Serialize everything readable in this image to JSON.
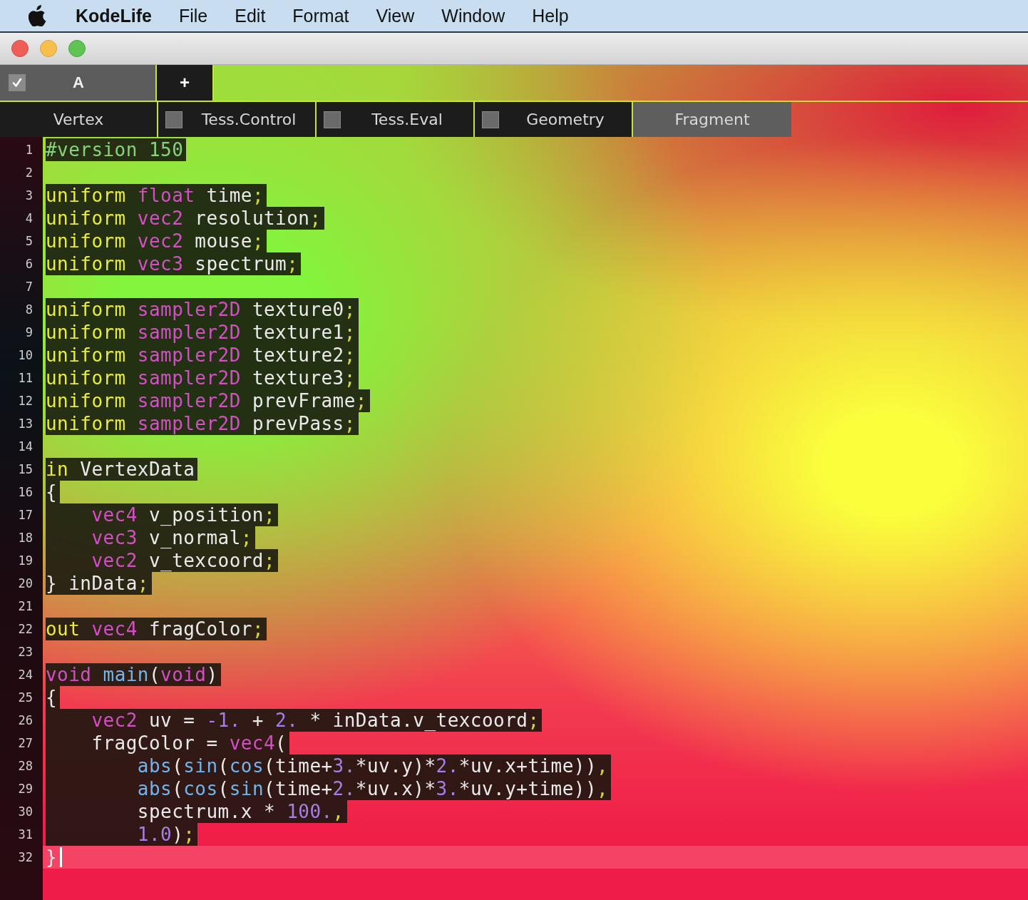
{
  "menu_bar": {
    "app": "KodeLife",
    "items": [
      "File",
      "Edit",
      "Format",
      "View",
      "Window",
      "Help"
    ]
  },
  "project_tabs": [
    {
      "kind": "project",
      "label": "A",
      "checked": true,
      "selected": true
    },
    {
      "kind": "add",
      "label": "+",
      "selected": false
    }
  ],
  "shader_tabs": [
    {
      "kind": "plain",
      "label": "Vertex",
      "selected": false
    },
    {
      "kind": "checkbox",
      "label": "Tess.Control",
      "checked": false,
      "selected": false
    },
    {
      "kind": "checkbox",
      "label": "Tess.Eval",
      "checked": false,
      "selected": false
    },
    {
      "kind": "checkbox",
      "label": "Geometry",
      "checked": false,
      "selected": false
    },
    {
      "kind": "plain",
      "label": "Fragment",
      "selected": true
    }
  ],
  "editor": {
    "lines": [
      {
        "number": "1",
        "tokens": [
          {
            "kind": "pre",
            "text": "#version 150"
          }
        ]
      },
      {
        "number": "2"
      },
      {
        "number": "3",
        "tokens": [
          {
            "kind": "kw",
            "text": "uniform"
          },
          {
            "kind": "type",
            "text": " float"
          },
          {
            "kind": "id",
            "text": " time"
          },
          {
            "kind": "punct",
            "text": ";"
          }
        ]
      },
      {
        "number": "4",
        "tokens": [
          {
            "kind": "kw",
            "text": "uniform"
          },
          {
            "kind": "type",
            "text": " vec2"
          },
          {
            "kind": "id",
            "text": " resolution"
          },
          {
            "kind": "punct",
            "text": ";"
          }
        ]
      },
      {
        "number": "5",
        "tokens": [
          {
            "kind": "kw",
            "text": "uniform"
          },
          {
            "kind": "type",
            "text": " vec2"
          },
          {
            "kind": "id",
            "text": " mouse"
          },
          {
            "kind": "punct",
            "text": ";"
          }
        ]
      },
      {
        "number": "6",
        "tokens": [
          {
            "kind": "kw",
            "text": "uniform"
          },
          {
            "kind": "type",
            "text": " vec3"
          },
          {
            "kind": "id",
            "text": " spectrum"
          },
          {
            "kind": "punct",
            "text": ";"
          }
        ]
      },
      {
        "number": "7"
      },
      {
        "number": "8",
        "tokens": [
          {
            "kind": "kw",
            "text": "uniform"
          },
          {
            "kind": "type",
            "text": " sampler2D"
          },
          {
            "kind": "id",
            "text": " texture0"
          },
          {
            "kind": "punct",
            "text": ";"
          }
        ]
      },
      {
        "number": "9",
        "tokens": [
          {
            "kind": "kw",
            "text": "uniform"
          },
          {
            "kind": "type",
            "text": " sampler2D"
          },
          {
            "kind": "id",
            "text": " texture1"
          },
          {
            "kind": "punct",
            "text": ";"
          }
        ]
      },
      {
        "number": "10",
        "tokens": [
          {
            "kind": "kw",
            "text": "uniform"
          },
          {
            "kind": "type",
            "text": " sampler2D"
          },
          {
            "kind": "id",
            "text": " texture2"
          },
          {
            "kind": "punct",
            "text": ";"
          }
        ]
      },
      {
        "number": "11",
        "tokens": [
          {
            "kind": "kw",
            "text": "uniform"
          },
          {
            "kind": "type",
            "text": " sampler2D"
          },
          {
            "kind": "id",
            "text": " texture3"
          },
          {
            "kind": "punct",
            "text": ";"
          }
        ]
      },
      {
        "number": "12",
        "tokens": [
          {
            "kind": "kw",
            "text": "uniform"
          },
          {
            "kind": "type",
            "text": " sampler2D"
          },
          {
            "kind": "id",
            "text": " prevFrame"
          },
          {
            "kind": "punct",
            "text": ";"
          }
        ]
      },
      {
        "number": "13",
        "tokens": [
          {
            "kind": "kw",
            "text": "uniform"
          },
          {
            "kind": "type",
            "text": " sampler2D"
          },
          {
            "kind": "id",
            "text": " prevPass"
          },
          {
            "kind": "punct",
            "text": ";"
          }
        ]
      },
      {
        "number": "14"
      },
      {
        "number": "15",
        "tokens": [
          {
            "kind": "kw",
            "text": "in"
          },
          {
            "kind": "id",
            "text": " VertexData"
          }
        ]
      },
      {
        "number": "16",
        "tokens": [
          {
            "kind": "id",
            "text": "{"
          }
        ]
      },
      {
        "number": "17",
        "tokens": [
          {
            "kind": "type",
            "text": "    vec4"
          },
          {
            "kind": "id",
            "text": " v_position"
          },
          {
            "kind": "punct",
            "text": ";"
          }
        ]
      },
      {
        "number": "18",
        "tokens": [
          {
            "kind": "type",
            "text": "    vec3"
          },
          {
            "kind": "id",
            "text": " v_normal"
          },
          {
            "kind": "punct",
            "text": ";"
          }
        ]
      },
      {
        "number": "19",
        "tokens": [
          {
            "kind": "type",
            "text": "    vec2"
          },
          {
            "kind": "id",
            "text": " v_texcoord"
          },
          {
            "kind": "punct",
            "text": ";"
          }
        ]
      },
      {
        "number": "20",
        "tokens": [
          {
            "kind": "id",
            "text": "} inData"
          },
          {
            "kind": "punct",
            "text": ";"
          }
        ]
      },
      {
        "number": "21"
      },
      {
        "number": "22",
        "tokens": [
          {
            "kind": "kw",
            "text": "out"
          },
          {
            "kind": "type",
            "text": " vec4"
          },
          {
            "kind": "id",
            "text": " fragColor"
          },
          {
            "kind": "punct",
            "text": ";"
          }
        ]
      },
      {
        "number": "23"
      },
      {
        "number": "24",
        "tokens": [
          {
            "kind": "type",
            "text": "void"
          },
          {
            "kind": "fn",
            "text": " main"
          },
          {
            "kind": "id",
            "text": "("
          },
          {
            "kind": "type",
            "text": "void"
          },
          {
            "kind": "id",
            "text": ")"
          }
        ]
      },
      {
        "number": "25",
        "tokens": [
          {
            "kind": "id",
            "text": "{"
          }
        ]
      },
      {
        "number": "26",
        "tokens": [
          {
            "kind": "type",
            "text": "    vec2"
          },
          {
            "kind": "id",
            "text": " uv = "
          },
          {
            "kind": "num",
            "text": "-1."
          },
          {
            "kind": "id",
            "text": " + "
          },
          {
            "kind": "num",
            "text": "2."
          },
          {
            "kind": "id",
            "text": " * inData.v_texcoord"
          },
          {
            "kind": "punct",
            "text": ";"
          }
        ]
      },
      {
        "number": "27",
        "tokens": [
          {
            "kind": "id",
            "text": "    fragColor = "
          },
          {
            "kind": "type",
            "text": "vec4"
          },
          {
            "kind": "id",
            "text": "("
          }
        ]
      },
      {
        "number": "28",
        "tokens": [
          {
            "kind": "fn",
            "text": "        abs"
          },
          {
            "kind": "id",
            "text": "("
          },
          {
            "kind": "fn",
            "text": "sin"
          },
          {
            "kind": "id",
            "text": "("
          },
          {
            "kind": "fn",
            "text": "cos"
          },
          {
            "kind": "id",
            "text": "(time+"
          },
          {
            "kind": "num",
            "text": "3."
          },
          {
            "kind": "id",
            "text": "*uv.y)*"
          },
          {
            "kind": "num",
            "text": "2."
          },
          {
            "kind": "id",
            "text": "*uv.x+time))"
          },
          {
            "kind": "punct",
            "text": ","
          }
        ]
      },
      {
        "number": "29",
        "tokens": [
          {
            "kind": "fn",
            "text": "        abs"
          },
          {
            "kind": "id",
            "text": "("
          },
          {
            "kind": "fn",
            "text": "cos"
          },
          {
            "kind": "id",
            "text": "("
          },
          {
            "kind": "fn",
            "text": "sin"
          },
          {
            "kind": "id",
            "text": "(time+"
          },
          {
            "kind": "num",
            "text": "2."
          },
          {
            "kind": "id",
            "text": "*uv.x)*"
          },
          {
            "kind": "num",
            "text": "3."
          },
          {
            "kind": "id",
            "text": "*uv.y+time))"
          },
          {
            "kind": "punct",
            "text": ","
          }
        ]
      },
      {
        "number": "30",
        "tokens": [
          {
            "kind": "id",
            "text": "        spectrum.x * "
          },
          {
            "kind": "num",
            "text": "100."
          },
          {
            "kind": "punct",
            "text": ","
          }
        ]
      },
      {
        "number": "31",
        "tokens": [
          {
            "kind": "num",
            "text": "        1.0"
          },
          {
            "kind": "id",
            "text": ")"
          },
          {
            "kind": "punct",
            "text": ";"
          }
        ]
      },
      {
        "number": "32",
        "cursor": true,
        "tokens": [
          {
            "kind": "id",
            "text": "}"
          }
        ]
      }
    ]
  }
}
